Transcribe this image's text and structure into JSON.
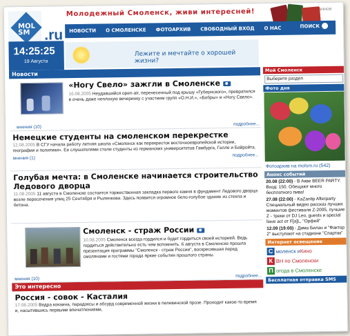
{
  "header": {
    "slogan": "Молодежный Смоленск, живи интересней!",
    "top_right": "в избранное",
    "logo_text": "MOL SM",
    "logo_ru": ".ru",
    "nav": [
      "НОВОСТИ",
      "О СМОЛЕНСКЕ",
      "ФОТОАРХИВ",
      "СВОБОДНЫЙ ВХОД",
      "О НАС"
    ],
    "search_label": "ПОИСК",
    "time": "14:25:25",
    "date": "19 Августа",
    "banner": "Лежите и мечтайте о хорошей жизни?"
  },
  "left": {
    "news_heading": "Новости",
    "articles": [
      {
        "title": "«Ногу Свело» зажгли в Смоленске",
        "date": "16.08.2005",
        "text": "Неудавшийся open-air, перенесенный под крышу «Губернского», превратился в очень даже неплохую вечеринку с участием групп «О.Н.И.», «Бобры» и «Ногу Свело».",
        "comments": "мнения (10)",
        "more": "подробнее..."
      },
      {
        "title": "Немецкие студенты на смоленском перекрестке",
        "date": "12.08.2005",
        "text": "В СГУ начала работу летняя школа «Смоленск как перекресток восточноевропейской истории, географии и политики». Ее слушателями стали студенты из германских университетов Гамбурга, Галле и Байройта.",
        "comments": "мнения (1)",
        "more": "подробнее..."
      },
      {
        "title": "Голубая мечта: в Смоленске начинается строительство Ледового дворца",
        "date": "11.08.2005",
        "text": "11 августа в Смоленске состоится торжественная закладка первого камня в фундамент Ледового дворца возле пересечения улиц 25 Сентября и Рыленкова. Здесь появится огромное бело-голубое здание из стекла и бетона.",
        "comments": "мнения (1)",
        "more": "подробнее..."
      },
      {
        "title": "Смоленск - страж России",
        "date": "10.08.2005",
        "text": "Смоленск всегда гордился и будет гордиться своей историей. Ведь гордиться действительно есть чем вспомнить. 6 августа в Смоленске прошла презентация программы \"Смоленск - страж России\", воскресившая перед смолянами и гостями города яркие события прошлого страны.",
        "comments": "мнения (10)",
        "more": "подробнее..."
      }
    ],
    "interesting_heading": "Это интересно",
    "interesting": {
      "title": "Россия - совок - Касталия",
      "date": "17.08.2005",
      "text": "Ведра кокаина, парадоксы и абсурд современной жизни в пелевинской прозе. Проходит какое-то время и, насытившись первыми впечатлениями,"
    }
  },
  "right": {
    "my_smolensk": "Мой Смоленск",
    "select_placeholder": "Выберите раздел",
    "photo_day": "Фото дня",
    "photo_link": "Фотоархив на molsm.ru (542)",
    "events_heading": "Анонс событий",
    "events": [
      {
        "time": "20.08 (22:00)",
        "text": " - В Акве BEER PARTY. Вход: 150. Обещают много бесплатного пива!"
      },
      {
        "time": "27.08 (22:00)",
        "text": " - KaZantip Afterparty Специальный видео рассказ лучших моментов фестиваля Z-2005, лучшие Z - треки от DJ Leo, guests и special liave act от F[a]L, \"Орфей\""
      },
      {
        "time": "12.09 (19:00)",
        "text": " - Дима Билан и \"Фактор 2\" выступают на стадионе \"Спартак\""
      }
    ],
    "internet_heading": "Интернет освещение",
    "partners": [
      {
        "letter": "С",
        "first": "моленск и ",
        "second": "Кино",
        "color": "#1d5aa0",
        "second_color": "#c0242a"
      },
      {
        "letter": "К",
        "first": "ВН по Смоленски",
        "second": "",
        "color": "#c0242a",
        "second_color": "#c0242a"
      },
      {
        "letter": "П",
        "first": "огода в Смоленске",
        "second": "",
        "color": "#2e8b3a",
        "second_color": "#2e8b3a"
      }
    ],
    "sms_heading": "Бесплатная отправка SMS"
  }
}
